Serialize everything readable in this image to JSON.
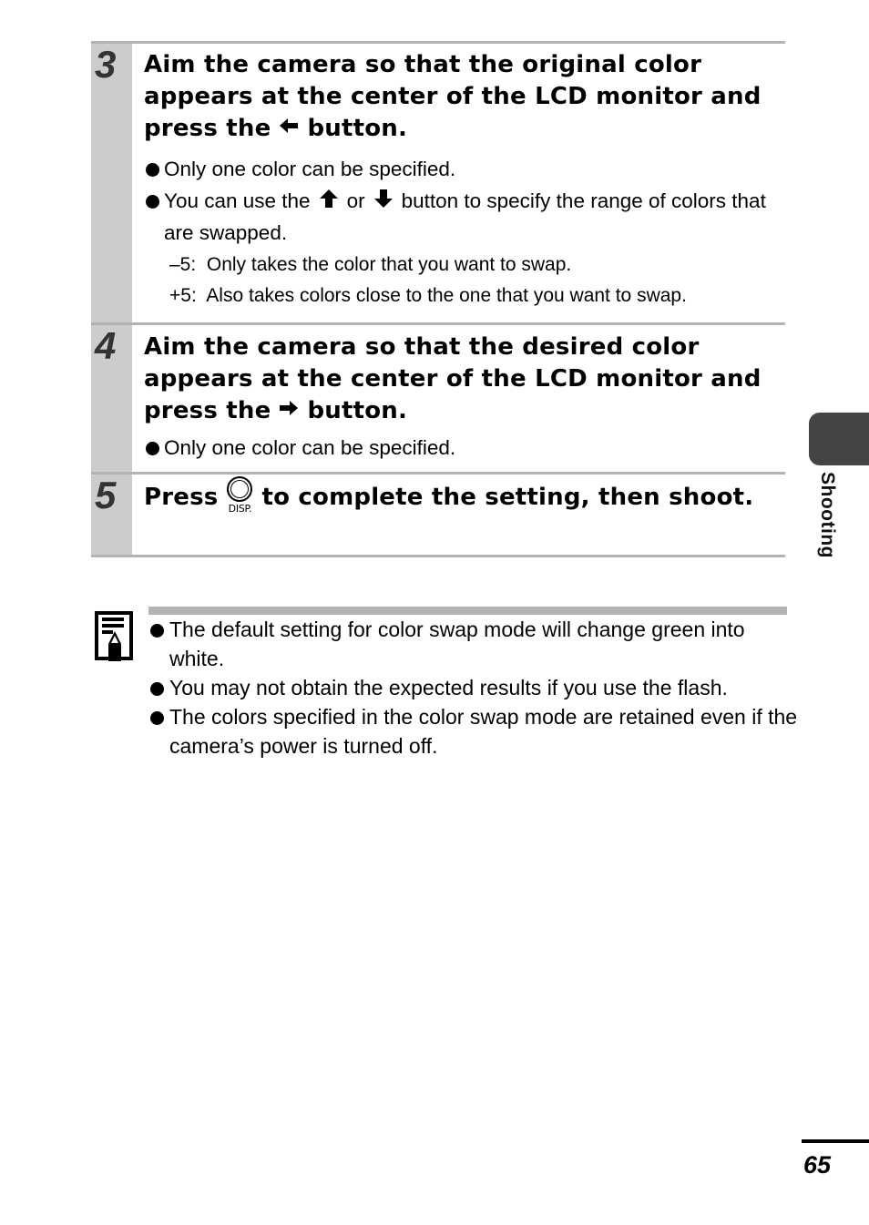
{
  "steps": [
    {
      "number": "3",
      "title_before": "Aim the camera so that the original color appears at the center of the LCD monitor and press the",
      "title_icon": "left-arrow-icon",
      "title_after": "button.",
      "bullets": [
        "Only one color can be specified."
      ],
      "range_bullet": {
        "before": "You can use the",
        "up_icon": "up-arrow-icon",
        "middle": "or",
        "down_icon": "down-arrow-icon",
        "after": "button to specify the range of colors that are swapped."
      },
      "range_values": [
        {
          "label": "–5:",
          "text": "Only takes the color that you want to swap."
        },
        {
          "label": "+5:",
          "text": "Also takes colors close to the one that you want to swap."
        }
      ]
    },
    {
      "number": "4",
      "title_before": "Aim the camera so that the desired color appears at the center of the LCD monitor and press the",
      "title_icon": "right-arrow-icon",
      "title_after": "button.",
      "bullets": [
        "Only one color can be specified."
      ]
    },
    {
      "number": "5",
      "title_before": "Press",
      "title_icon": "disp-button-icon",
      "icon_label": "DISP.",
      "title_after": "to complete the setting, then shoot."
    }
  ],
  "note": {
    "icon": "note-pencil-icon",
    "bullets": [
      "The default setting for color swap mode will change green into white.",
      "You may not obtain the expected results if you use the flash.",
      "The colors specified in the color swap mode are retained even if the camera’s power is turned off."
    ]
  },
  "side_tab": {
    "label": "Shooting"
  },
  "footer": {
    "page_number": "65"
  }
}
